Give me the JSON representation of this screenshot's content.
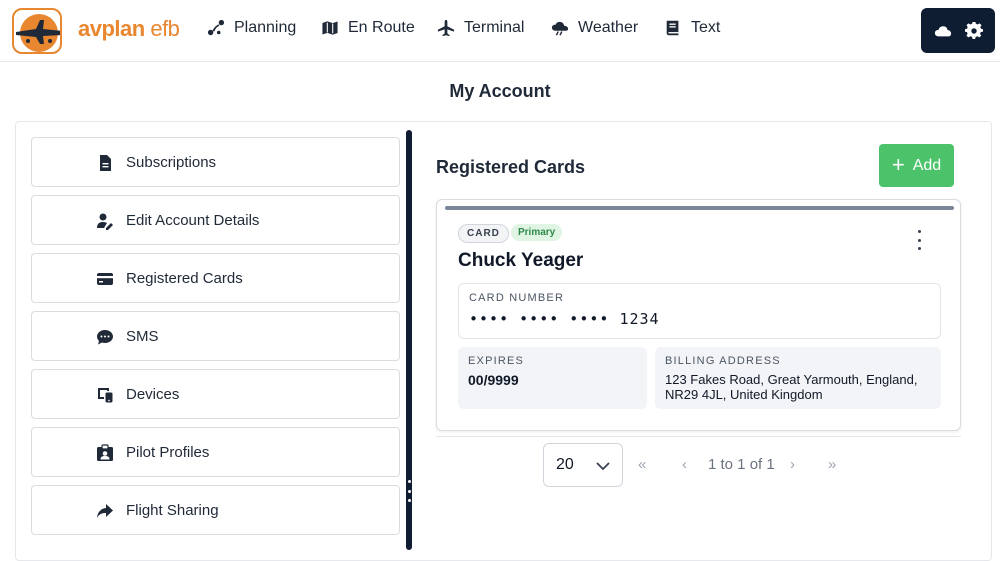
{
  "brand": {
    "name_part1": "avplan",
    "name_part2": "efb"
  },
  "nav": [
    {
      "label": "Planning",
      "icon": "route-icon"
    },
    {
      "label": "En Route",
      "icon": "map-icon"
    },
    {
      "label": "Terminal",
      "icon": "plane-icon"
    },
    {
      "label": "Weather",
      "icon": "cloud-weather-icon"
    },
    {
      "label": "Text",
      "icon": "book-icon"
    }
  ],
  "top_right": {
    "icons": [
      "cloud-icon",
      "gear-icon"
    ]
  },
  "page": {
    "title": "My Account"
  },
  "sidebar": {
    "items": [
      {
        "label": "Subscriptions",
        "icon": "document-icon"
      },
      {
        "label": "Edit Account Details",
        "icon": "user-edit-icon"
      },
      {
        "label": "Registered Cards",
        "icon": "credit-card-icon"
      },
      {
        "label": "SMS",
        "icon": "sms-icon"
      },
      {
        "label": "Devices",
        "icon": "devices-icon"
      },
      {
        "label": "Pilot Profiles",
        "icon": "id-badge-icon"
      },
      {
        "label": "Flight Sharing",
        "icon": "share-arrow-icon"
      }
    ]
  },
  "main": {
    "section_title": "Registered Cards",
    "add_label": "Add",
    "card": {
      "type_badge": "CARD",
      "primary_badge": "Primary",
      "name": "Chuck Yeager",
      "number_label": "CARD NUMBER",
      "number": "•••• •••• •••• 1234",
      "expires_label": "EXPIRES",
      "expires": "00/9999",
      "billing_label": "BILLING ADDRESS",
      "billing": "123 Fakes Road, Great Yarmouth, England, NR29 4JL, United Kingdom"
    },
    "pager": {
      "page_size": "20",
      "first": "«",
      "prev": "‹",
      "info": "1 to 1 of 1",
      "next": "›",
      "last": "»"
    }
  },
  "colors": {
    "brand_orange": "#e8872f",
    "navy": "#0f1d33",
    "add_green": "#4cc26a",
    "primary_badge_bg": "#dff4e3"
  }
}
